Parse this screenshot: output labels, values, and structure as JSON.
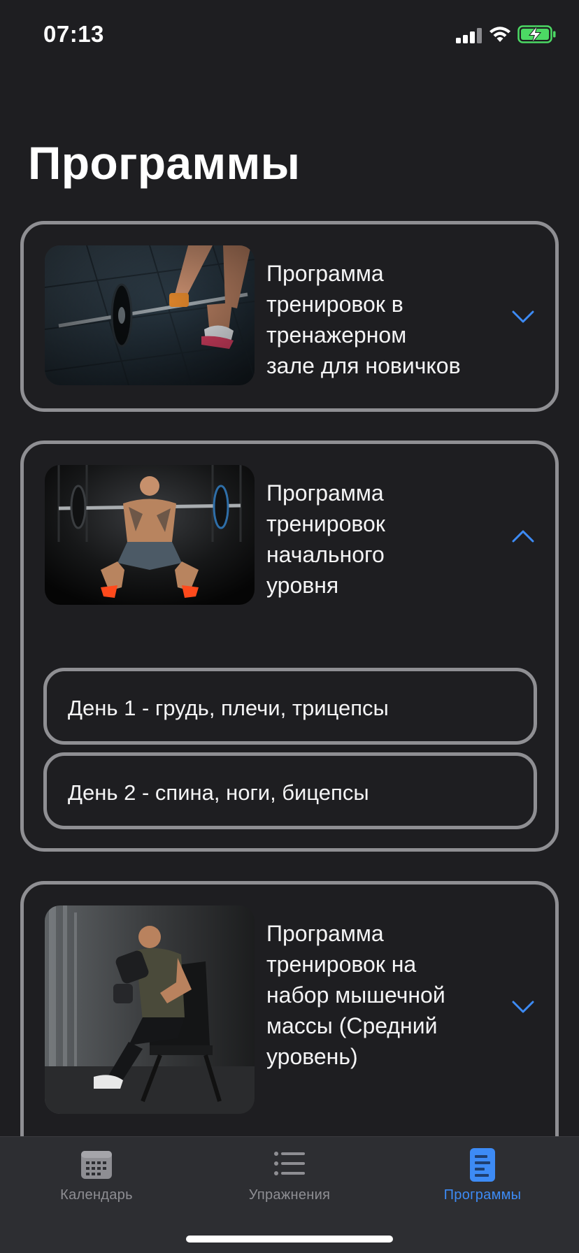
{
  "status_bar": {
    "time": "07:13"
  },
  "page": {
    "title": "Программы"
  },
  "programs": [
    {
      "title_lines": [
        "Программа",
        "тренировок в",
        "тренажерном",
        "зале для новичков"
      ],
      "expanded": false,
      "photo": "barbell-deadlift-photo"
    },
    {
      "title_lines": [
        "Программа",
        "тренировок",
        "начального",
        "уровня"
      ],
      "expanded": true,
      "photo": "front-squat-photo",
      "days": [
        {
          "label": "День 1 - грудь, плечи, трицепсы"
        },
        {
          "label": "День 2 - спина, ноги, бицепсы"
        }
      ]
    },
    {
      "title_lines": [
        "Программа",
        "тренировок на",
        "набор мышечной",
        "массы (Средний",
        "уровень)"
      ],
      "expanded": false,
      "photo": "dumbbell-curl-photo"
    }
  ],
  "tab_bar": {
    "tabs": [
      {
        "label": "Календарь",
        "icon": "calendar-icon",
        "active": false
      },
      {
        "label": "Упражнения",
        "icon": "list-icon",
        "active": false
      },
      {
        "label": "Программы",
        "icon": "document-icon",
        "active": true
      }
    ]
  },
  "colors": {
    "accent": "#3d8bf5",
    "background": "#1e1e21",
    "card_border": "#8f8f93",
    "tab_bar": "#2d2e32",
    "battery": "#4cd964"
  }
}
